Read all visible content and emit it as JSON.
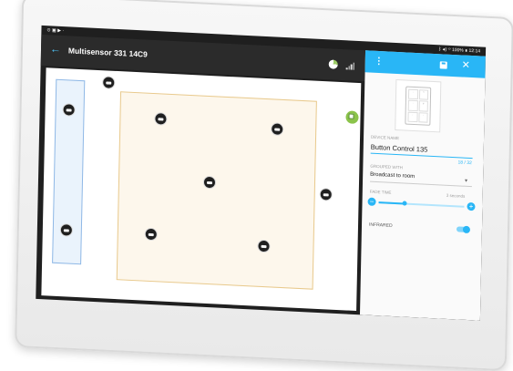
{
  "status": {
    "left_icons": "⊙ ▣ ▶ ·",
    "right": "ᛒ ◀) ⌔ 100% ▮ 12:14"
  },
  "appbar": {
    "title": "Multisensor 331 14C9"
  },
  "panel": {
    "device_name_label": "DEVICE NAME",
    "device_name_value": "Button Control 135",
    "device_name_counter": "18 / 32",
    "grouped_with_label": "GROUPED WITH",
    "grouped_with_value": "Broadcast to room",
    "fade_time_label": "FADE TIME",
    "fade_time_value": "3 seconds",
    "fade_time_level": 0.3,
    "infrared_label": "INFRARED",
    "infrared_on": true
  },
  "colors": {
    "accent": "#29b6f6",
    "zone_blue": "#8fb8e6",
    "zone_orange": "#e8c98c",
    "sensor_green": "#8bc34a"
  }
}
